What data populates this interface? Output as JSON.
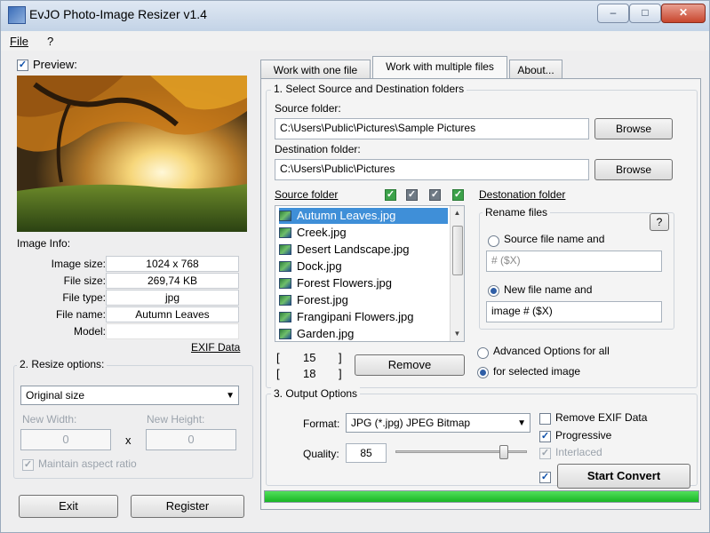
{
  "window": {
    "title": "EvJO Photo-Image Resizer v1.4",
    "controls": {
      "minimize": "–",
      "maximize": "□",
      "close": "✕"
    }
  },
  "menu": {
    "file": "File",
    "help": "?"
  },
  "preview": {
    "checkbox_label": "Preview:",
    "checked": true,
    "image_info_label": "Image Info:",
    "rows": [
      {
        "label": "Image size:",
        "value": "1024 x 768"
      },
      {
        "label": "File size:",
        "value": "269,74 KB"
      },
      {
        "label": "File type:",
        "value": "jpg"
      },
      {
        "label": "File name:",
        "value": "Autumn Leaves"
      },
      {
        "label": "Model:",
        "value": ""
      }
    ],
    "exif_link": "EXIF Data"
  },
  "resize": {
    "legend": "2. Resize options:",
    "mode": "Original size",
    "new_width_label": "New Width:",
    "new_width": "0",
    "times": "x",
    "new_height_label": "New Height:",
    "new_height": "0",
    "maintain_label": "Maintain aspect ratio"
  },
  "bottom_buttons": {
    "exit": "Exit",
    "register": "Register"
  },
  "tabs": [
    {
      "label": "Work with one file"
    },
    {
      "label": "Work with multiple files"
    },
    {
      "label": "About..."
    }
  ],
  "section1": {
    "legend": "1. Select Source and Destination folders",
    "source_label": "Source folder:",
    "source_value": "C:\\Users\\Public\\Pictures\\Sample Pictures",
    "browse_source": "Browse",
    "dest_label": "Destination folder:",
    "dest_value": "C:\\Users\\Public\\Pictures",
    "browse_dest": "Browse"
  },
  "file_list": {
    "header": "Source folder",
    "items": [
      "Autumn Leaves.jpg",
      "Creek.jpg",
      "Desert Landscape.jpg",
      "Dock.jpg",
      "Forest Flowers.jpg",
      "Forest.jpg",
      "Frangipani Flowers.jpg",
      "Garden.jpg"
    ],
    "selected_index": 0,
    "count_total": "15",
    "count_selected": "18",
    "bracket_open": "[",
    "bracket_close": "]",
    "remove_button": "Remove"
  },
  "destination": {
    "header": "Destonation folder",
    "rename_legend": "Rename files",
    "help_button": "?",
    "opt_source_name": "Source file name and",
    "source_pattern": "# ($X)",
    "opt_new_name": "New file name and",
    "new_pattern": "image # ($X)",
    "adv_all": "Advanced Options for all",
    "adv_selected": "for selected image"
  },
  "output": {
    "legend": "3. Output Options",
    "format_label": "Format:",
    "format_value": "JPG (*.jpg) JPEG Bitmap",
    "quality_label": "Quality:",
    "quality_value": "85",
    "quality_level": 85,
    "remove_exif": "Remove EXIF Data",
    "progressive": "Progressive",
    "interlaced": "Interlaced",
    "start_button": "Start Convert"
  },
  "progress": {
    "fraction": 1.0
  },
  "colors": {
    "progress": "#18b524",
    "selection": "#3f8fd8",
    "check_green": "#3ca24a"
  }
}
